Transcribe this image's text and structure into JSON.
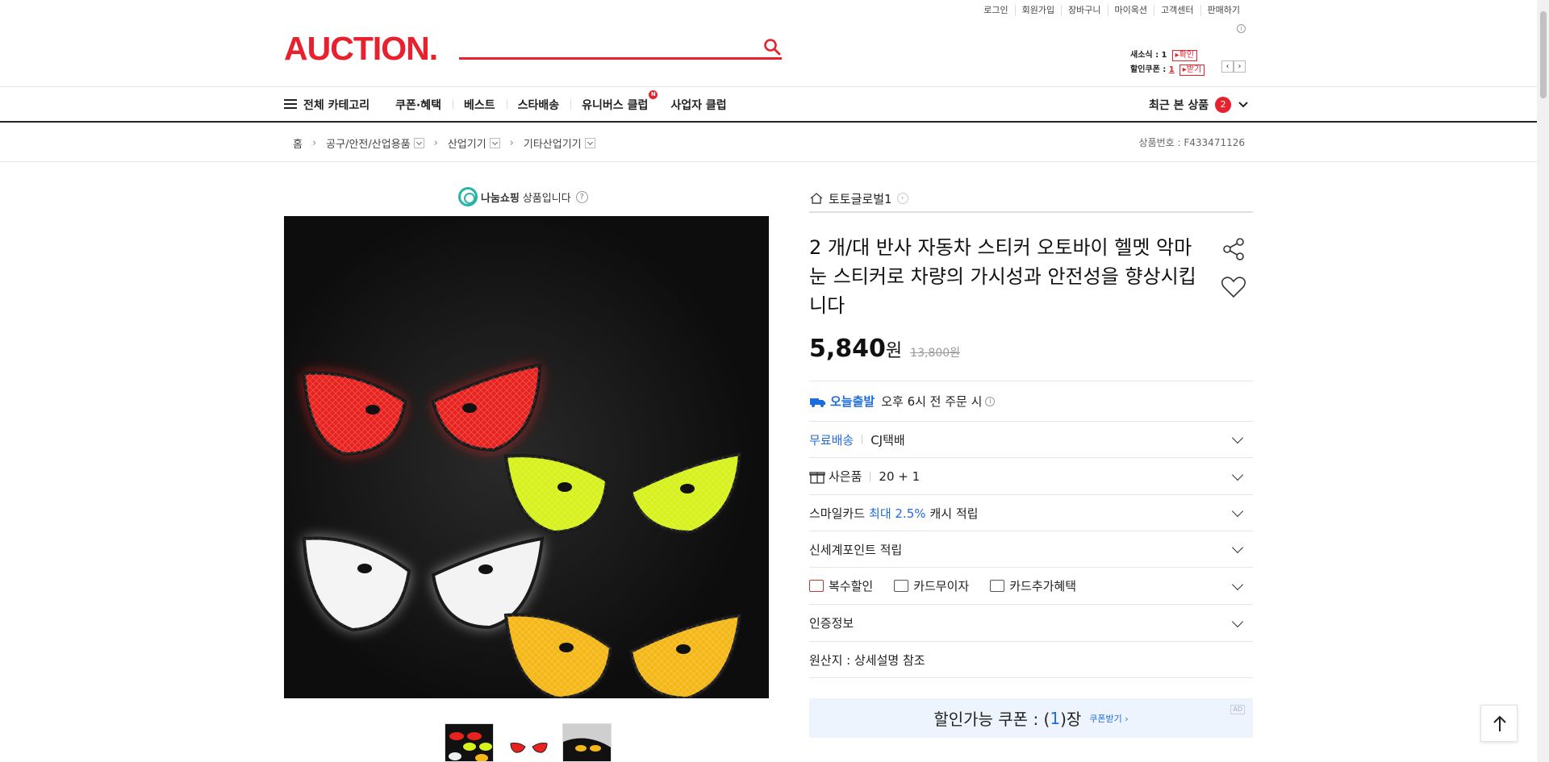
{
  "util_links": [
    "로그인",
    "회원가입",
    "장바구니",
    "마이옥션",
    "고객센터",
    "판매하기"
  ],
  "logo": "AUCTION.",
  "search": {
    "placeholder": "",
    "icon": "search-icon"
  },
  "mini": {
    "new_msg_label": "새소식 : 1",
    "new_msg_tag": "확인",
    "coupon_label": "할인쿠폰 : ",
    "coupon_count": "1",
    "coupon_tag": "받기"
  },
  "nav": {
    "all_categories": "전체 카테고리",
    "items": [
      "쿠폰·혜택",
      "베스트",
      "스타배송",
      "유니버스 클럽",
      "사업자 클럽"
    ],
    "universe_badge": "N",
    "recent_label": "최근 본 상품",
    "recent_count": "2"
  },
  "breadcrumb": {
    "home": "홈",
    "level1": "공구/안전/산업용품",
    "level2": "산업기기",
    "level3": "기타산업기기",
    "product_no": "상품번호 : F433471126"
  },
  "nanum": {
    "brand": "나눔쇼핑",
    "text": "상품입니다"
  },
  "seller": {
    "name": "토토글로벌1"
  },
  "product": {
    "title": "2 개/대 반사 자동차 스티커 오토바이 헬멧 악마 눈 스티커로 차량의 가시성과 안전성을 향상시킵니다",
    "price": "5,840",
    "won": "원",
    "original_price": "13,800원"
  },
  "rows": {
    "today_label": "오늘출발",
    "today_text": "오후 6시 전 주문 시",
    "shipping_free": "무료배송",
    "courier": "CJ택배",
    "gift_label": "사은품",
    "gift_value": "20 + 1",
    "smile_a": "스마일카드",
    "smile_b": "최대 2.5%",
    "smile_c": "캐시 적립",
    "shinsegae": "신세계포인트 적립",
    "multi_discount": "복수할인",
    "card_installment": "카드무이자",
    "card_benefit": "카드추가혜택",
    "cert": "인증정보",
    "origin": "원산지 : 상세설명 참조"
  },
  "coupon": {
    "label": "할인가능 쿠폰 : (",
    "count": "1",
    "suffix": ")장",
    "get": "쿠폰받기 ›",
    "ad": "AD"
  },
  "colors": {
    "brand_red": "#e8212e",
    "link_blue": "#1f6cdc"
  }
}
